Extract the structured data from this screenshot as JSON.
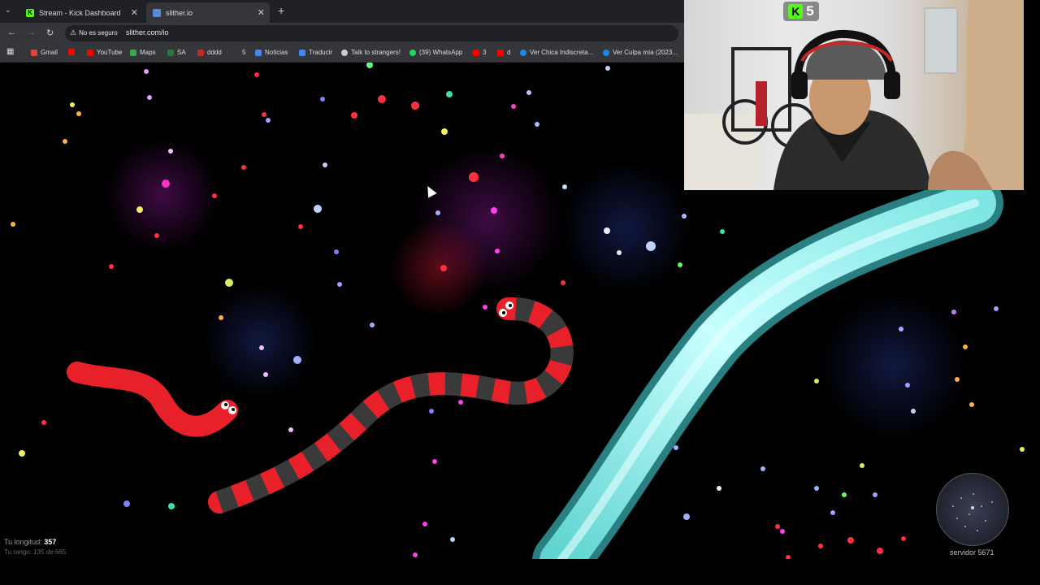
{
  "browser": {
    "tabs": [
      {
        "title": "Stream - Kick Dashboard",
        "active": false,
        "icon": "kick-logo-icon"
      },
      {
        "title": "slither.io",
        "active": true,
        "icon": "slither-icon"
      }
    ],
    "address": {
      "security_label": "No es seguro",
      "url": "slither.com/io"
    },
    "bookmarks": [
      {
        "label": "",
        "icon": "apps-grid-icon"
      },
      {
        "label": "Gmail",
        "icon": "gmail-icon",
        "color": "#ea4335"
      },
      {
        "label": "",
        "icon": "youtube-icon",
        "color": "#ff0000"
      },
      {
        "label": "YouTube",
        "icon": "youtube-icon",
        "color": "#ff0000"
      },
      {
        "label": "Maps",
        "icon": "maps-icon",
        "color": "#34a853"
      },
      {
        "label": "SA",
        "icon": "sa-icon",
        "color": "#2a7a3a"
      },
      {
        "label": "dddd",
        "icon": "bookmark-red-icon",
        "color": "#c62828"
      },
      {
        "label": "5",
        "icon": "",
        "color": ""
      },
      {
        "label": "Noticias",
        "icon": "news-icon",
        "color": "#4285f4"
      },
      {
        "label": "Traducir",
        "icon": "translate-icon",
        "color": "#4285f4"
      },
      {
        "label": "Talk to strangers!",
        "icon": "chat-icon",
        "color": "#cccccc"
      },
      {
        "label": "(39) WhatsApp",
        "icon": "whatsapp-icon",
        "color": "#25d366"
      },
      {
        "label": "3",
        "icon": "youtube-icon",
        "color": "#ff0000"
      },
      {
        "label": "d",
        "icon": "youtube-icon",
        "color": "#ff0000"
      },
      {
        "label": "Ver Chica Indiscreta...",
        "icon": "globe-icon",
        "color": "#1e88e5"
      },
      {
        "label": "Ver Culpa mía (2023...",
        "icon": "globe-icon",
        "color": "#1e88e5"
      }
    ]
  },
  "stream_overlay": {
    "kick_viewers": "5",
    "kick_color": "#53fc18"
  },
  "game": {
    "length_label": "Tu longitud:",
    "length_value": "357",
    "rank_text": "Tu rango: 135 de 665",
    "server_text": "servidor 5671",
    "snake_colors": {
      "red": "#e8202a",
      "dark": "#3a3a3a",
      "cyan": "#8ff0ee"
    }
  }
}
